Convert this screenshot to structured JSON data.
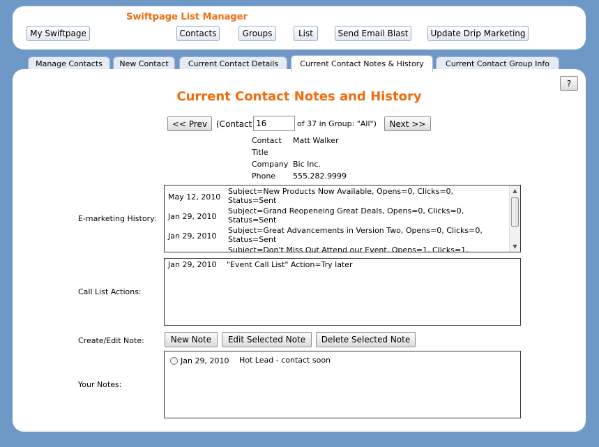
{
  "header": {
    "app_title": "Swiftpage List Manager",
    "nav": {
      "my_swiftpage": "My Swiftpage",
      "contacts": "Contacts",
      "groups": "Groups",
      "list": "List",
      "send_email_blast": "Send Email Blast",
      "update_drip_marketing": "Update Drip Marketing"
    }
  },
  "tabs": [
    {
      "label": "Manage Contacts"
    },
    {
      "label": "New Contact"
    },
    {
      "label": "Current Contact Details"
    },
    {
      "label": "Current Contact Notes & History"
    },
    {
      "label": "Current Contact Group Info"
    }
  ],
  "help_label": "?",
  "page_title": "Current Contact Notes and History",
  "pager": {
    "prev_label": "<< Prev",
    "contact_prefix": "(Contact",
    "contact_value": "16",
    "contact_suffix": "of 37 in Group: \"All\")",
    "next_label": "Next >>"
  },
  "contact": {
    "contact_label": "Contact",
    "contact_value": "Matt Walker",
    "title_label": "Title",
    "title_value": "",
    "company_label": "Company",
    "company_value": "Bic Inc.",
    "phone_label": "Phone",
    "phone_value": "555.282.9999"
  },
  "emarketing": {
    "label": "E-marketing History:",
    "rows": [
      {
        "date": "May 12, 2010",
        "subject": "Subject=New Products Now Available, Opens=0, Clicks=0, Status=Sent"
      },
      {
        "date": "Jan 29, 2010",
        "subject": "Subject=Grand Reopeneing Great Deals, Opens=0, Clicks=0, Status=Sent"
      },
      {
        "date": "Jan 29, 2010",
        "subject": "Subject=Great Advancements in Version Two, Opens=0, Clicks=0, Status=Sent"
      },
      {
        "date": "",
        "subject": "Subject=Don't Miss Out Attend our Event, Opens=1, Clicks=1,"
      }
    ]
  },
  "call_list": {
    "label": "Call List Actions:",
    "rows": [
      {
        "date": "Jan 29, 2010",
        "text": "\"Event Call List\" Action=Try later"
      }
    ]
  },
  "notes_actions": {
    "label": "Create/Edit Note:",
    "new_note": "New Note",
    "edit_note": "Edit Selected Note",
    "delete_note": "Delete Selected Note"
  },
  "your_notes": {
    "label": "Your Notes:",
    "rows": [
      {
        "date": "Jan 29, 2010",
        "text": "Hot Lead - contact soon"
      }
    ]
  },
  "colors": {
    "accent": "#f26c0d",
    "background": "#6e99c6"
  }
}
